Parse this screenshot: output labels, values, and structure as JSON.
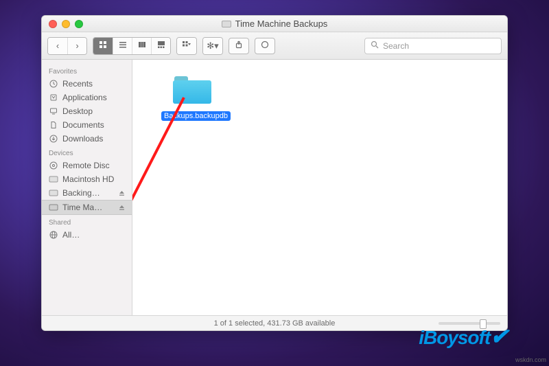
{
  "window": {
    "title": "Time Machine Backups"
  },
  "toolbar": {
    "back_label": "‹",
    "forward_label": "›"
  },
  "search": {
    "placeholder": "Search"
  },
  "sidebar": {
    "groups": [
      {
        "header": "Favorites",
        "items": [
          {
            "label": "Recents",
            "icon": "clock-icon"
          },
          {
            "label": "Applications",
            "icon": "app-icon"
          },
          {
            "label": "Desktop",
            "icon": "desktop-icon"
          },
          {
            "label": "Documents",
            "icon": "documents-icon"
          },
          {
            "label": "Downloads",
            "icon": "downloads-icon"
          }
        ]
      },
      {
        "header": "Devices",
        "items": [
          {
            "label": "Remote Disc",
            "icon": "disc-icon"
          },
          {
            "label": "Macintosh HD",
            "icon": "hd-icon"
          },
          {
            "label": "Backing…",
            "icon": "hd-icon",
            "eject": true
          },
          {
            "label": "Time Ma…",
            "icon": "hd-icon",
            "eject": true,
            "selected": true
          }
        ]
      },
      {
        "header": "Shared",
        "items": [
          {
            "label": "All…",
            "icon": "network-icon"
          }
        ]
      }
    ]
  },
  "main": {
    "items": [
      {
        "label": "Backups.backupdb",
        "selected": true
      }
    ]
  },
  "statusbar": {
    "text": "1 of 1 selected, 431.73 GB available"
  },
  "watermark": "iBoysoft",
  "attribution": "wskdn.com"
}
